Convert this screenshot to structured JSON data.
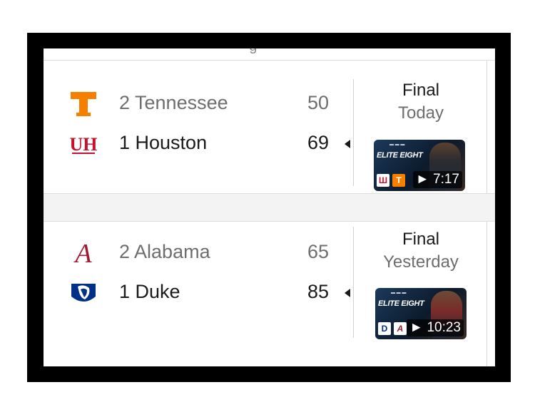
{
  "games": [
    {
      "status": "Final",
      "when": "Today",
      "video_duration": "7:17",
      "video_brand": "ELITE EIGHT",
      "teams": [
        {
          "seed_name": "2 Tennessee",
          "score": "50",
          "winner": false,
          "logo": "tennessee-power-t-icon"
        },
        {
          "seed_name": "1 Houston",
          "score": "69",
          "winner": true,
          "logo": "houston-uh-icon"
        }
      ]
    },
    {
      "status": "Final",
      "when": "Yesterday",
      "video_duration": "10:23",
      "video_brand": "ELITE EIGHT",
      "teams": [
        {
          "seed_name": "2 Alabama",
          "score": "65",
          "winner": false,
          "logo": "alabama-script-a-icon"
        },
        {
          "seed_name": "1 Duke",
          "score": "85",
          "winner": true,
          "logo": "duke-blue-devil-icon"
        }
      ]
    }
  ],
  "colors": {
    "tennessee_orange": "#F77F00",
    "houston_red": "#C8102E",
    "alabama_crimson": "#9E1B32",
    "duke_blue": "#003087"
  }
}
